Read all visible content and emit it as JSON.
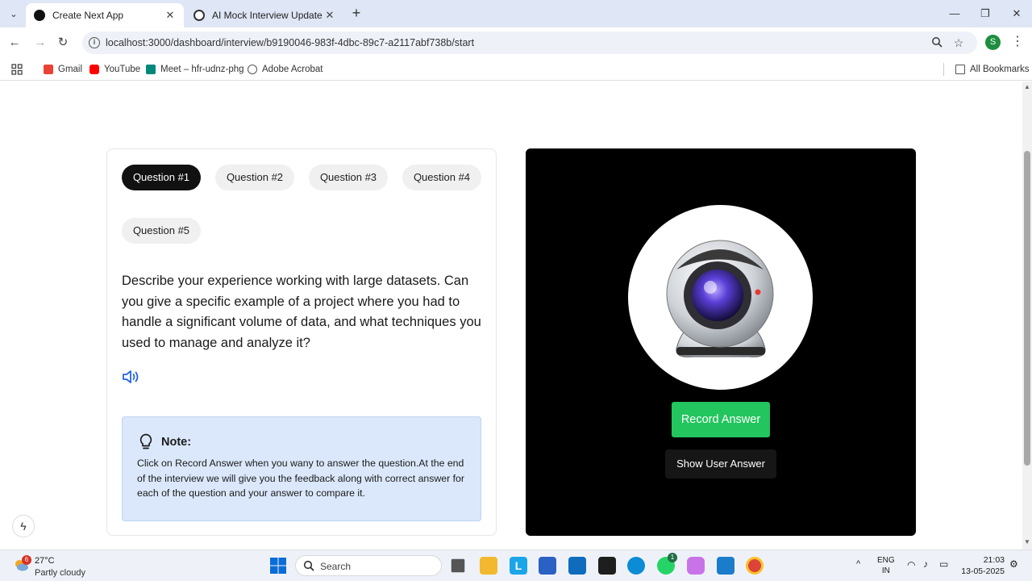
{
  "browser": {
    "tabs": [
      {
        "title": "Create Next App",
        "active": true
      },
      {
        "title": "AI Mock Interview Update",
        "active": false
      }
    ],
    "url": "localhost:3000/dashboard/interview/b9190046-983f-4dbc-89c7-a2117abf738b/start",
    "profile_initial": "S",
    "bookmarks": [
      {
        "label": "Gmail",
        "icon": "gmail-icon",
        "color": "#ea4335"
      },
      {
        "label": "YouTube",
        "icon": "youtube-icon",
        "color": "#ff0000"
      },
      {
        "label": "Meet – hfr-udnz-phg",
        "icon": "meet-icon",
        "color": "#00897b"
      },
      {
        "label": "Adobe Acrobat",
        "icon": "globe-icon",
        "color": "#555555"
      }
    ],
    "all_bookmarks": "All Bookmarks"
  },
  "interview": {
    "questions": [
      "Question #1",
      "Question #2",
      "Question #3",
      "Question #4",
      "Question #5"
    ],
    "active_index": 0,
    "question_text": "Describe your experience working with large datasets. Can you give a specific example of a project where you had to handle a significant volume of data, and what techniques you used to manage and analyze it?",
    "note_title": "Note:",
    "note_body": "Click on Record Answer when you wany to answer the question.At the end of the interview we will give you the feedback along with correct answer for each of the question and your answer to compare it.",
    "record_label": "Record Answer",
    "show_answer_label": "Show User Answer",
    "accent_color": "#22c55e"
  },
  "taskbar": {
    "weather_badge": "6",
    "temperature": "27°C",
    "condition": "Partly cloudy",
    "search_label": "Search",
    "whatsapp_badge": "1",
    "language": "ENG",
    "region": "IN",
    "time": "21:03",
    "date": "13-05-2025"
  }
}
